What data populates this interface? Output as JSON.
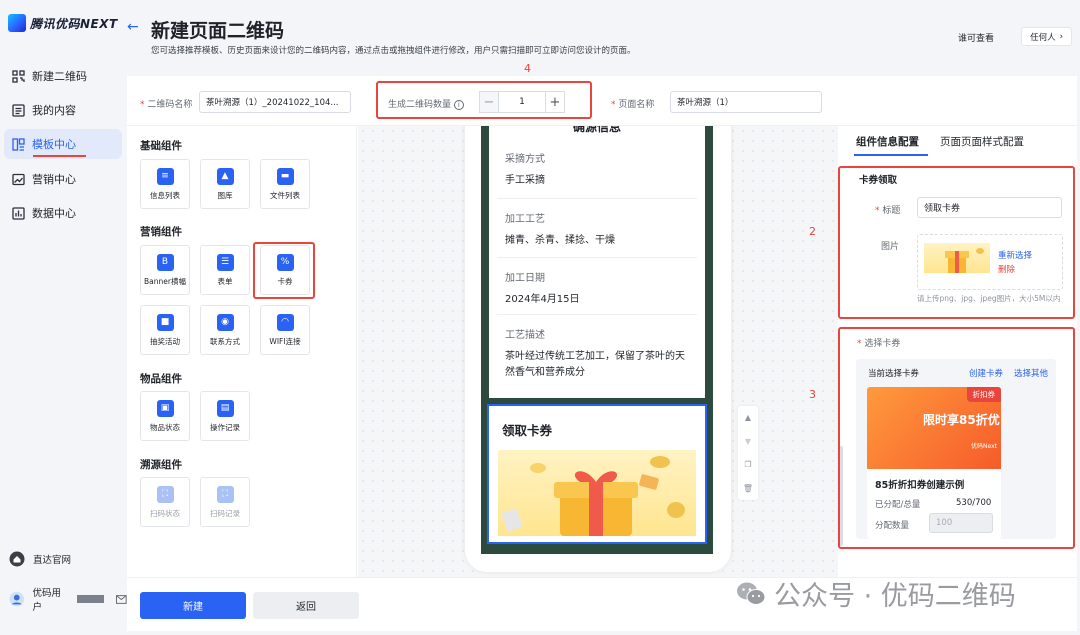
{
  "brand": {
    "name": "腾讯优码NEXT"
  },
  "sidebar": {
    "items": [
      {
        "label": "新建二维码",
        "icon": "qrcode-icon"
      },
      {
        "label": "我的内容",
        "icon": "document-icon"
      },
      {
        "label": "模板中心",
        "icon": "template-icon",
        "active": true
      },
      {
        "label": "营销中心",
        "icon": "image-chart-icon"
      },
      {
        "label": "数据中心",
        "icon": "bar-chart-icon"
      }
    ],
    "official_site": "直达官网",
    "user": "优码用户"
  },
  "header": {
    "title": "新建页面二维码",
    "subtitle": "您可选择推荐模板、历史页面来设计您的二维码内容，通过点击或拖拽组件进行修改，用户只需扫描即可立即访问您设计的页面。",
    "viewer_label": "谁可查看",
    "viewer_value": "任何人"
  },
  "form": {
    "qr_name_label": "二维码名称",
    "qr_name_value": "茶叶溯源（1）_20241022_104...",
    "count_label": "生成二维码数量",
    "count_value": "1",
    "page_name_label": "页面名称",
    "page_name_value": "茶叶溯源（1）"
  },
  "annotations": {
    "n1": "2",
    "n2": "3",
    "n3": "4"
  },
  "palette": {
    "basic": {
      "title": "基础组件",
      "items": [
        "信息列表",
        "图库",
        "文件列表"
      ]
    },
    "marketing": {
      "title": "营销组件",
      "items": [
        "Banner横幅",
        "表单",
        "卡券",
        "抽奖活动",
        "联系方式",
        "WIFI连接"
      ]
    },
    "goods": {
      "title": "物品组件",
      "items": [
        "物品状态",
        "操作记录"
      ]
    },
    "trace": {
      "title": "溯源组件",
      "items": [
        "扫码状态",
        "扫码记录"
      ]
    }
  },
  "preview": {
    "section_title": "确源信息",
    "rows": [
      {
        "k": "采摘方式",
        "v": "手工采摘"
      },
      {
        "k": "加工工艺",
        "v": "摊青、杀青、揉捻、干燥"
      },
      {
        "k": "加工日期",
        "v": "2024年4月15日"
      },
      {
        "k": "工艺描述",
        "v": "茶叶经过传统工艺加工，保留了茶叶的天然香气和营养成分"
      }
    ],
    "coupon_title": "领取卡券"
  },
  "config": {
    "tab_active": "组件信息配置",
    "tab_other": "页面页面样式配置",
    "section": "卡券领取",
    "title_label": "标题",
    "title_value": "领取卡券",
    "image_label": "图片",
    "reselect": "重新选择",
    "delete": "删除",
    "hint": "请上传png、jpg、jpeg图片，大小5M以内",
    "select_label": "选择卡券",
    "current_label": "当前选择卡券",
    "create_link": "创建卡券",
    "other_link": "选择其他",
    "coupon_badge": "折扣券",
    "coupon_banner_text": "限时享85折优",
    "coupon_banner_small": "优码Next",
    "coupon_name": "85折折扣券创建示例",
    "alloc_label": "已分配/总量",
    "alloc_value": "530/700",
    "qty_label": "分配数量",
    "qty_placeholder": "100"
  },
  "footer": {
    "create": "新建",
    "back": "返回"
  },
  "watermark": {
    "text": "公众号 · 优码二维码"
  },
  "colors": {
    "accent": "#2a63f3",
    "danger": "#e8453c",
    "tea": "#2c4a3e"
  }
}
